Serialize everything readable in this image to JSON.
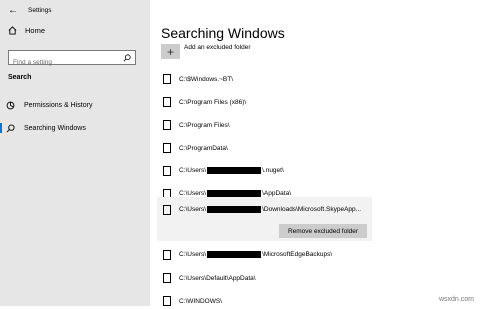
{
  "window": {
    "title": "Settings"
  },
  "sidebar": {
    "home_label": "Home",
    "search_placeholder": "Find a setting",
    "section_title": "Search",
    "items": [
      {
        "label": "Permissions & History",
        "icon": "permissions-icon"
      },
      {
        "label": "Searching Windows",
        "icon": "search-icon",
        "active": true
      }
    ]
  },
  "main": {
    "title": "Searching Windows",
    "add_excluded_label": "Add an excluded folder",
    "remove_button_label": "Remove excluded folder",
    "folders": [
      {
        "prefix": "C:\\$Windows.~BT\\",
        "redacted": false,
        "suffix": ""
      },
      {
        "prefix": "C:\\Program Files (x86)\\",
        "redacted": false,
        "suffix": ""
      },
      {
        "prefix": "C:\\Program Files\\",
        "redacted": false,
        "suffix": ""
      },
      {
        "prefix": "C:\\ProgramData\\",
        "redacted": false,
        "suffix": ""
      },
      {
        "prefix": "C:\\Users\\",
        "redacted": true,
        "suffix": "\\.nuget\\"
      },
      {
        "prefix": "C:\\Users\\",
        "redacted": true,
        "suffix": "\\AppData\\"
      },
      {
        "prefix": "C:\\Users\\",
        "redacted": true,
        "suffix": "\\Downloads\\Microsoft.SkypeApp...",
        "selected": true
      },
      {
        "prefix": "C:\\Users\\",
        "redacted": true,
        "suffix": "\\MicrosoftEdgeBackups\\"
      },
      {
        "prefix": "C:\\Users\\Default\\AppData\\",
        "redacted": false,
        "suffix": ""
      },
      {
        "prefix": "C:\\WINDOWS\\",
        "redacted": false,
        "suffix": ""
      }
    ]
  },
  "watermark": "wsxdn.com",
  "colors": {
    "sidebar_bg": "#e6e6e6",
    "accent": "#0078d7",
    "button_bg": "#cccccc",
    "selected_bg": "#f2f2f2"
  }
}
